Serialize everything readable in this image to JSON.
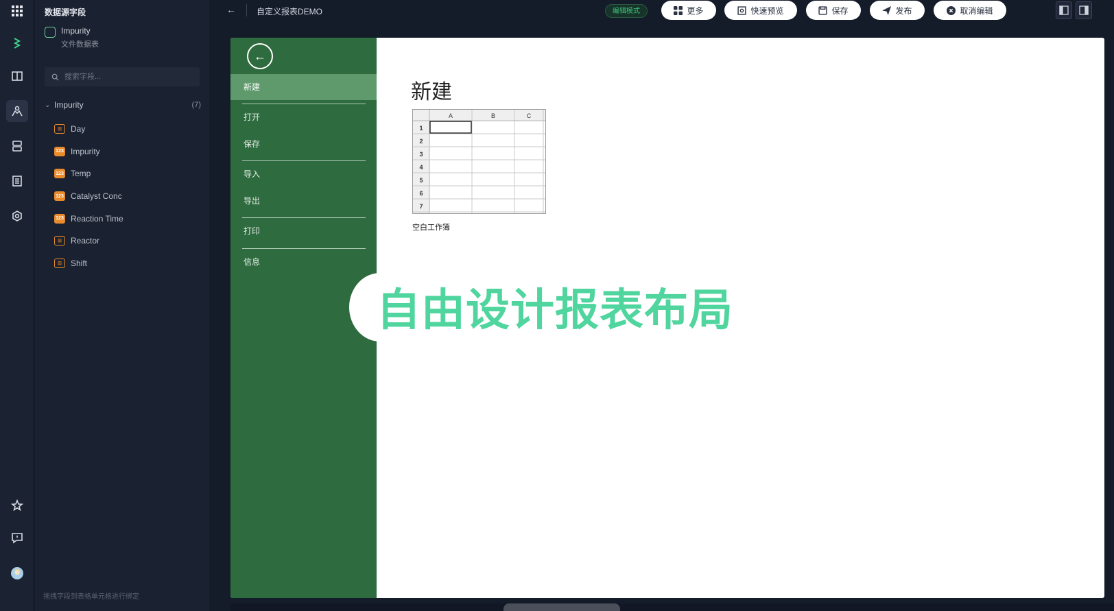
{
  "topbar": {
    "back_glyph": "←",
    "title": "自定义报表DEMO",
    "mode_badge": "编辑模式",
    "buttons": [
      {
        "id": "more",
        "label": "更多",
        "icon": "grid-icon"
      },
      {
        "id": "preview",
        "label": "快速预览",
        "icon": "preview-icon"
      },
      {
        "id": "save",
        "label": "保存",
        "icon": "save-icon"
      },
      {
        "id": "publish",
        "label": "发布",
        "icon": "send-icon"
      },
      {
        "id": "cancel",
        "label": "取消编辑",
        "icon": "cancel-icon"
      }
    ]
  },
  "rail": {
    "items": [
      "apps-grid-icon",
      "brand-logo-icon",
      "book-icon",
      "dataset-icon",
      "database-icon",
      "report-icon",
      "settings-icon",
      "star-icon",
      "feedback-icon",
      "avatar"
    ]
  },
  "fieldpanel": {
    "title": "数据源字段",
    "source_name": "Impurity",
    "source_type": "文件数据表",
    "search_placeholder": "搜索字段...",
    "group_name": "Impurity",
    "group_count": "(7)",
    "fields": [
      {
        "name": "Day",
        "type": "date"
      },
      {
        "name": "Impurity",
        "type": "number"
      },
      {
        "name": "Temp",
        "type": "number"
      },
      {
        "name": "Catalyst Conc",
        "type": "number"
      },
      {
        "name": "Reaction Time",
        "type": "number"
      },
      {
        "name": "Reactor",
        "type": "date"
      },
      {
        "name": "Shift",
        "type": "date"
      }
    ],
    "footer_hint": "拖拽字段到表格单元格进行绑定"
  },
  "backstage": {
    "back_glyph": "←",
    "nav": [
      {
        "label": "新建",
        "selected": true
      },
      {
        "label": "打开",
        "selected": false
      },
      {
        "label": "保存",
        "selected": false
      },
      {
        "label": "导入",
        "selected": false
      },
      {
        "label": "导出",
        "selected": false
      },
      {
        "label": "打印",
        "selected": false
      },
      {
        "label": "信息",
        "selected": false
      }
    ],
    "heading": "新建",
    "workbook": {
      "columns": [
        "A",
        "B",
        "C"
      ],
      "rows": [
        "1",
        "2",
        "3",
        "4",
        "5",
        "6",
        "7"
      ],
      "label": "空白工作簿"
    },
    "overlay_caption": "自由设计报表布局",
    "colors": {
      "nav_bg": "#2e6b3e",
      "nav_selected": "#5f9a6c",
      "overlay_text": "#4fd59d",
      "mode_badge": "#3fbf7b"
    }
  }
}
